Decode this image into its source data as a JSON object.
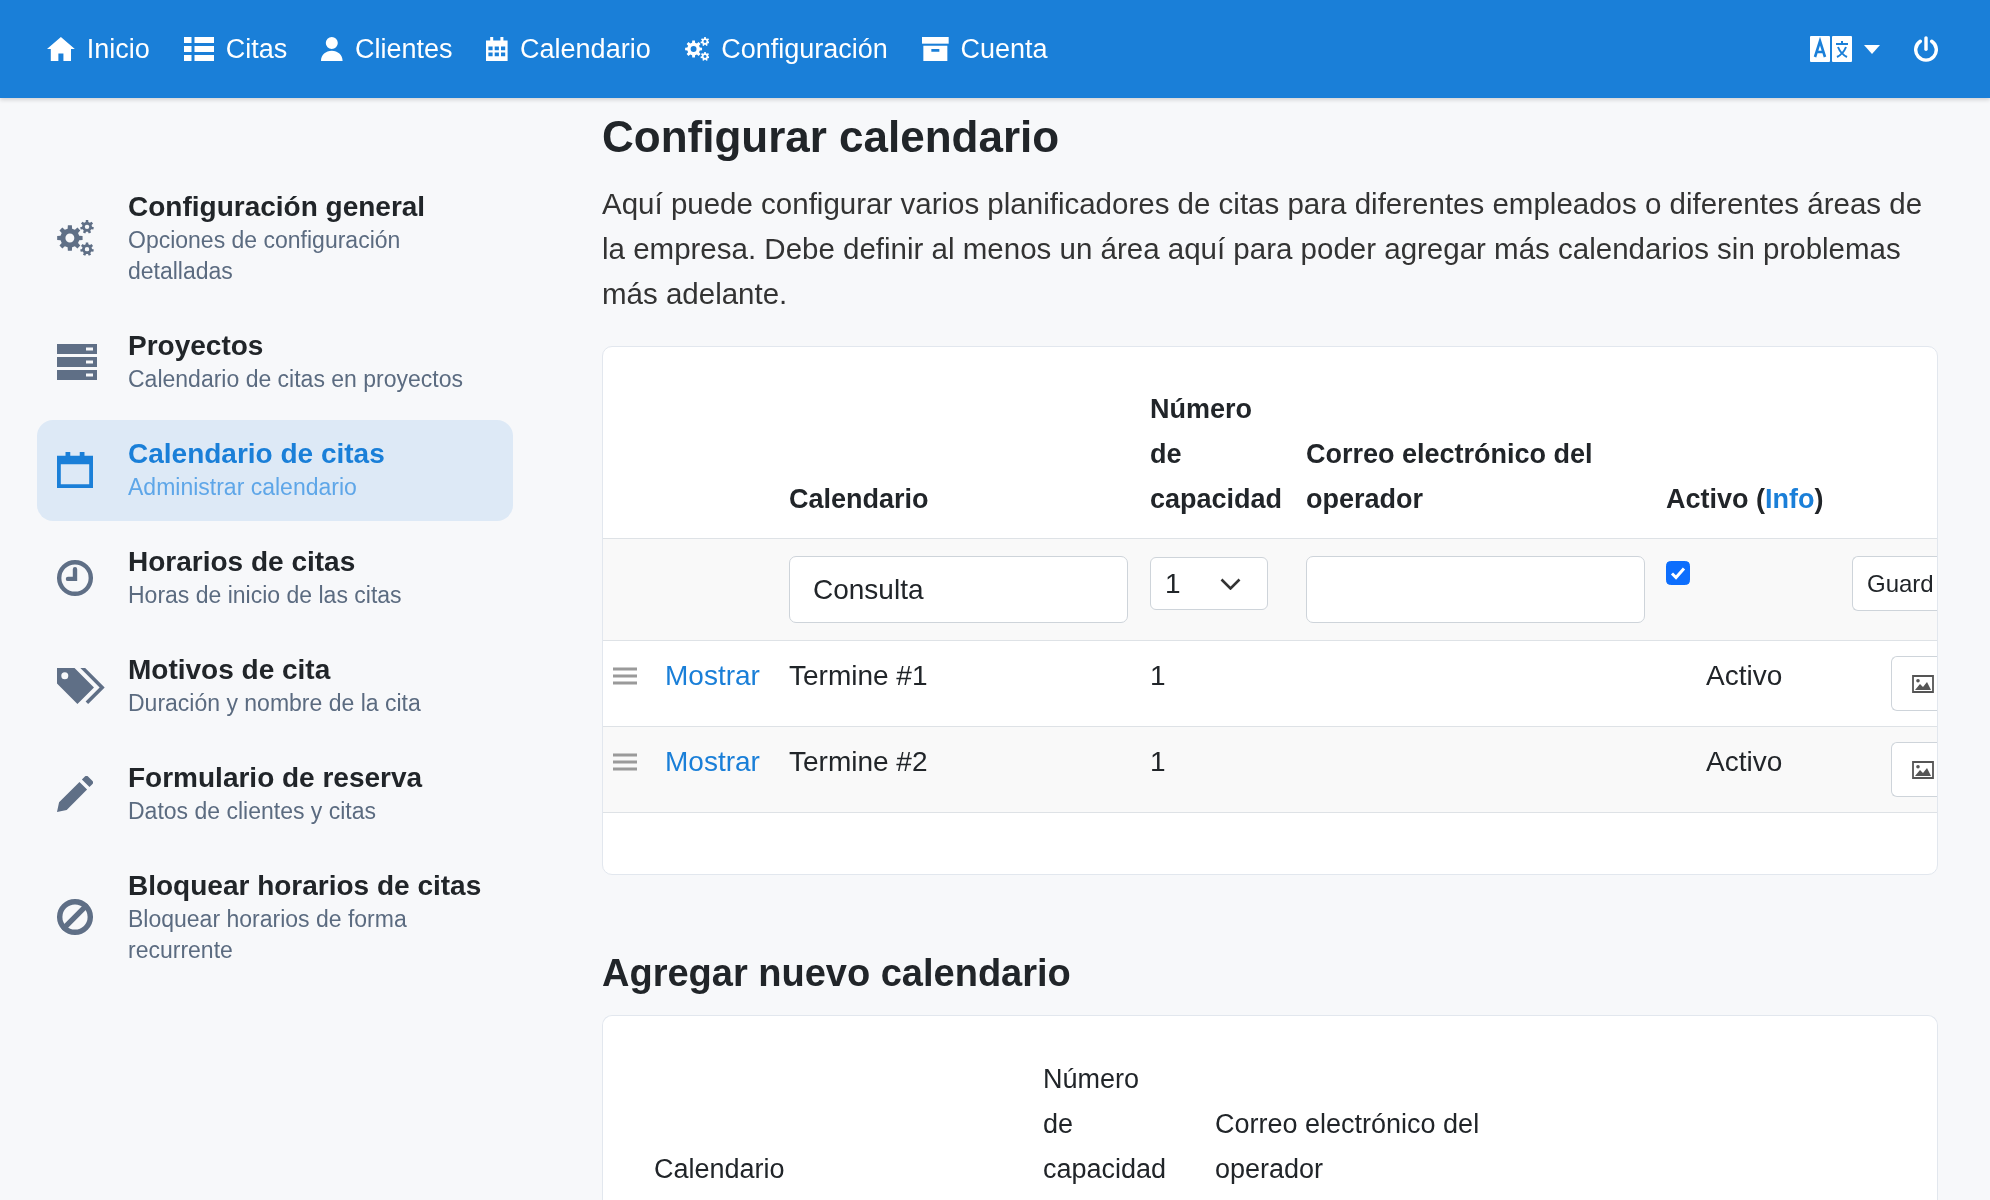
{
  "navbar": {
    "items": [
      "Inicio",
      "Citas",
      "Clientes",
      "Calendario",
      "Configuración",
      "Cuenta"
    ]
  },
  "sidebar": {
    "items": [
      {
        "title": "Configuración general",
        "subtitle": "Opciones de configuración detalladas",
        "selected": false
      },
      {
        "title": "Proyectos",
        "subtitle": "Calendario de citas en proyectos",
        "selected": false
      },
      {
        "title": "Calendario de citas",
        "subtitle": "Administrar calendario",
        "selected": true
      },
      {
        "title": "Horarios de citas",
        "subtitle": "Horas de inicio de las citas",
        "selected": false
      },
      {
        "title": "Motivos de cita",
        "subtitle": "Duración y nombre de la cita",
        "selected": false
      },
      {
        "title": "Formulario de reserva",
        "subtitle": "Datos de clientes y citas",
        "selected": false
      },
      {
        "title": "Bloquear horarios de citas",
        "subtitle": "Bloquear horarios de forma recurrente",
        "selected": false
      }
    ]
  },
  "main": {
    "title": "Configurar calendario",
    "intro": "Aquí puede configurar varios planificadores de citas para diferentes empleados o diferentes áreas de la empresa. Debe definir al menos un área aquí para poder agregar más calendarios sin problemas más adelante.",
    "calendars_table": {
      "columns": [
        {
          "label": "Calendario"
        },
        {
          "label": "Número de capacidad"
        },
        {
          "label": "Correo electrónico del operador"
        },
        {
          "label": "Activo (",
          "link": "Info",
          "label_after": ")"
        }
      ],
      "new_row": {
        "name": "Consulta",
        "capacity": "1",
        "active": true,
        "save_button": "Guard"
      },
      "rows": [
        {
          "link": "Mostrar",
          "name": "Termine #1",
          "capacity": "1",
          "status": "Activo"
        },
        {
          "link": "Mostrar",
          "name": "Termine #2",
          "capacity": "1",
          "status": "Activo"
        }
      ]
    },
    "add_title": "Agregar nuevo calendario",
    "new_calendar_table": {
      "columns": [
        "Calendario",
        "Número de capacidad",
        "Correo electrónico del operador"
      ]
    }
  }
}
